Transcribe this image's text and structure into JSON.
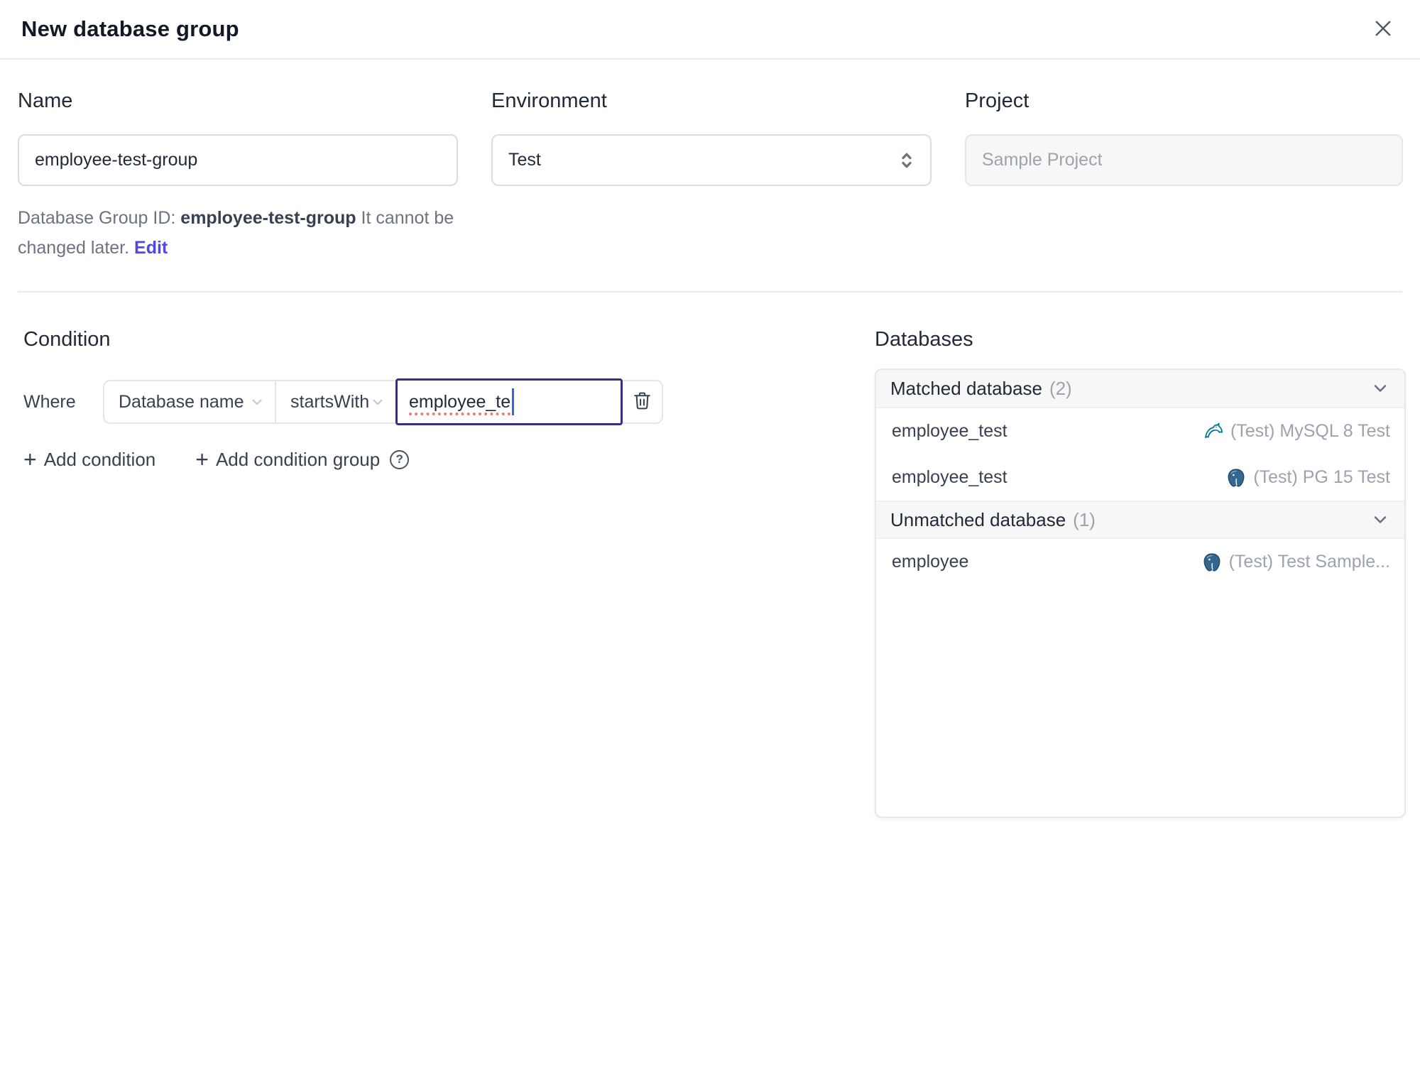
{
  "dialog": {
    "title": "New database group"
  },
  "form": {
    "name": {
      "label": "Name",
      "value": "employee-test-group"
    },
    "environment": {
      "label": "Environment",
      "value": "Test"
    },
    "project": {
      "label": "Project",
      "value": "Sample Project"
    },
    "group_id_hint": {
      "prefix": "Database Group ID: ",
      "id": "employee-test-group",
      "suffix": " It cannot be changed later. ",
      "edit_label": "Edit"
    }
  },
  "condition": {
    "heading": "Condition",
    "where_label": "Where",
    "field_selected": "Database name",
    "operator_selected": "startsWith",
    "value": "employee_te",
    "plus_glyph": "+",
    "add_condition_label": "Add condition",
    "add_condition_group_label": "Add condition group",
    "help_glyph": "?"
  },
  "databases": {
    "heading": "Databases",
    "sections": [
      {
        "title": "Matched database",
        "count": "(2)",
        "rows": [
          {
            "name": "employee_test",
            "engine": "mysql",
            "instance": "(Test) MySQL 8 Test"
          },
          {
            "name": "employee_test",
            "engine": "postgres",
            "instance": "(Test) PG 15 Test"
          }
        ]
      },
      {
        "title": "Unmatched database",
        "count": "(1)",
        "rows": [
          {
            "name": "employee",
            "engine": "postgres",
            "instance": "(Test) Test Sample..."
          }
        ]
      }
    ]
  },
  "colors": {
    "accent": "#4f46e5",
    "focus_border": "#342e86",
    "mysql": "#00758f",
    "postgres": "#336791",
    "muted_text": "#9ca3af",
    "spellcheck_underline": "#ee7b72"
  }
}
